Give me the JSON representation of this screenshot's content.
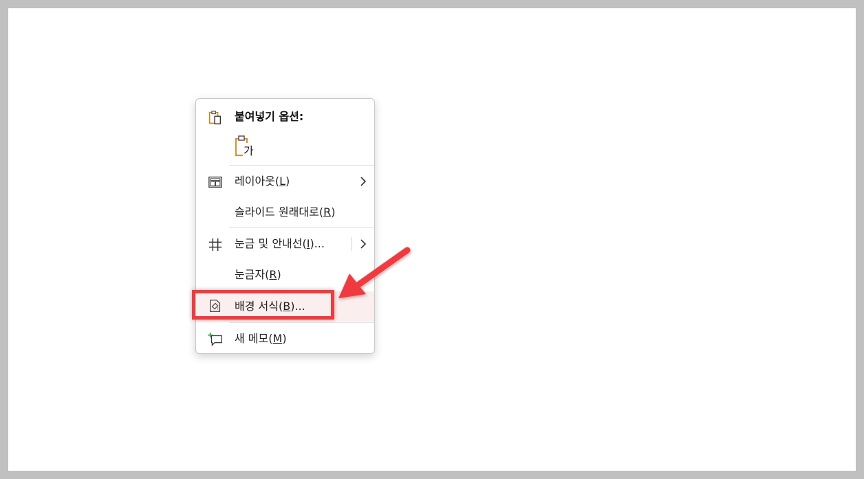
{
  "context_menu": {
    "paste_header": "붙여넣기 옵션:",
    "paste_option_glyph": "가",
    "layout": {
      "text": "레이아웃(",
      "key": "L",
      "tail": ")"
    },
    "reset_slide": {
      "text": "슬라이드 원래대로(",
      "key": "R",
      "tail": ")"
    },
    "grid_guides": {
      "text": "눈금 및 안내선(",
      "key": "I",
      "tail": ")..."
    },
    "ruler": {
      "text": "눈금자(",
      "key": "R",
      "tail": ")"
    },
    "format_background": {
      "text": "배경 서식(",
      "key": "B",
      "tail": ")..."
    },
    "new_comment": {
      "text": "새 메모(",
      "key": "M",
      "tail": ")"
    }
  },
  "colors": {
    "accent_orange": "#d97f1f",
    "annotation_red": "#ef3b3f",
    "comment_green": "#2f9e47"
  },
  "icons": [
    "clipboard-paste-icon",
    "paste-keep-text-icon",
    "layout-icon",
    "grid-icon",
    "format-background-icon",
    "new-comment-icon",
    "chevron-right-icon"
  ]
}
